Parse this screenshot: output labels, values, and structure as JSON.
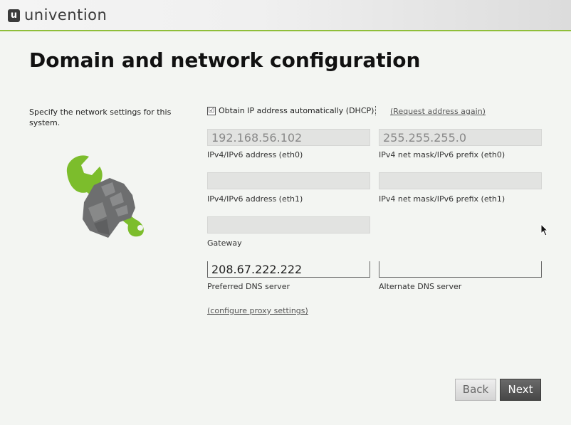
{
  "header": {
    "logo_letter": "u",
    "brand": "univention"
  },
  "page": {
    "title": "Domain and network configuration"
  },
  "intro": {
    "text": "Specify the network settings for this system."
  },
  "dhcp": {
    "checked": true,
    "check_mark": "☑",
    "label": "Obtain IP address automatically (DHCP)",
    "request_link": "(Request address again)"
  },
  "fields": {
    "ip_eth0": {
      "value": "192.168.56.102",
      "label": "IPv4/IPv6 address (eth0)"
    },
    "mask_eth0": {
      "value": "255.255.255.0",
      "label": "IPv4 net mask/IPv6 prefix (eth0)"
    },
    "ip_eth1": {
      "value": "",
      "label": "IPv4/IPv6 address (eth1)"
    },
    "mask_eth1": {
      "value": "",
      "label": "IPv4 net mask/IPv6 prefix (eth1)"
    },
    "gateway": {
      "value": "",
      "label": "Gateway"
    },
    "dns_preferred": {
      "value": "208.67.222.222",
      "label": "Preferred DNS server"
    },
    "dns_alternate": {
      "value": "",
      "label": "Alternate DNS server"
    }
  },
  "proxy_link": "(configure proxy settings)",
  "buttons": {
    "back": "Back",
    "next": "Next"
  },
  "icons": {
    "illustration": "wrench-hand-icon",
    "cursor": "mouse-pointer-icon"
  },
  "colors": {
    "accent": "#8fbe3a",
    "title": "#111111",
    "button_primary": "#555555"
  }
}
